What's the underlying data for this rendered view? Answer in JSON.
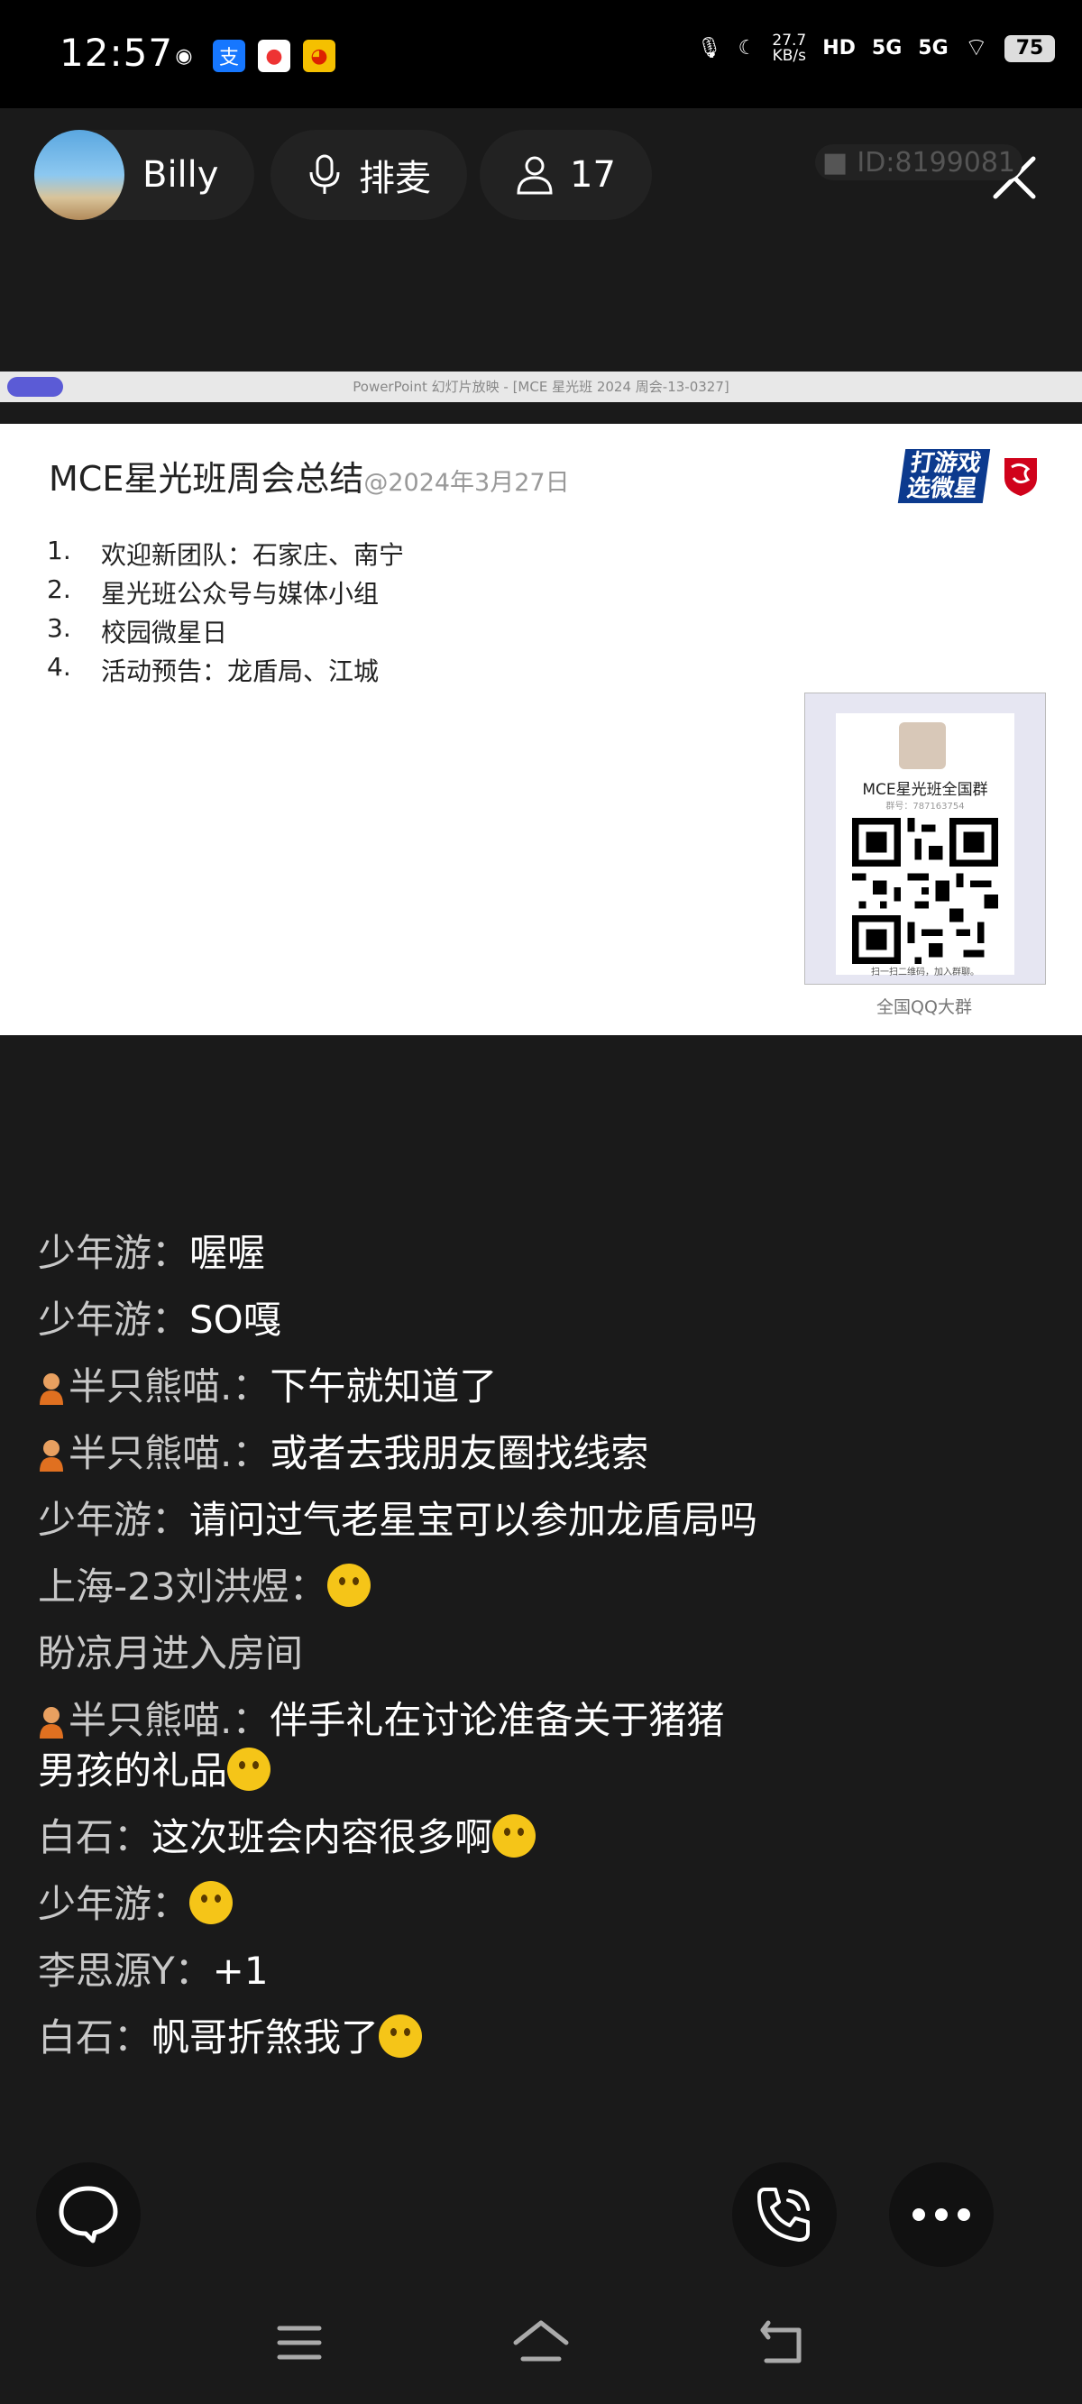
{
  "status_bar": {
    "time": "12:57",
    "apps": [
      "browser-icon",
      "alipay-icon",
      "maps-icon",
      "weibo-icon"
    ],
    "speed_value": "27.7",
    "speed_unit": "KB/s",
    "hd_label": "HD",
    "net1": "5G",
    "net2": "5G",
    "battery": "75"
  },
  "room": {
    "host_name": "Billy",
    "queue_label": "排麦",
    "audience_count": "17",
    "room_id": "ID:8199081"
  },
  "slide": {
    "ppt_title": "PowerPoint 幻灯片放映 - [MCE 星光班 2024 周会-13-0327]",
    "title": "MCE星光班周会总结",
    "date": "@2024年3月27日",
    "brand_line1": "打游戏",
    "brand_line2": "选微星",
    "agenda": [
      {
        "num": "1.",
        "text": "欢迎新团队：石家庄、南宁"
      },
      {
        "num": "2.",
        "text": "星光班公众号与媒体小组"
      },
      {
        "num": "3.",
        "text": "校园微星日"
      },
      {
        "num": "4.",
        "text": "活动预告：龙盾局、江城"
      }
    ],
    "qr": {
      "group_name": "MCE星光班全国群",
      "group_no": "群号：787163754",
      "scan_hint": "扫一扫二维码，加入群聊。",
      "caption": "全国QQ大群"
    }
  },
  "chat": {
    "messages": [
      {
        "user": "少年游：",
        "text": "喔喔"
      },
      {
        "user": "少年游：",
        "text": "SO嘎"
      },
      {
        "user": "半只熊喵.：",
        "text": "下午就知道了"
      },
      {
        "user": "半只熊喵.：",
        "text": "或者去我朋友圈找线索"
      },
      {
        "user": "少年游：",
        "text": "请问过气老星宝可以参加龙盾局吗"
      },
      {
        "user": "上海-23刘洪煜：",
        "text": ""
      },
      {
        "system": "盼凉月进入房间"
      },
      {
        "user": "半只熊喵.：",
        "text": "伴手礼在讨论准备关于猪猪男孩的礼品"
      },
      {
        "user": "白石：",
        "text": "这次班会内容很多啊"
      },
      {
        "user": "少年游：",
        "text": ""
      },
      {
        "user": "李思源Y：",
        "text": "+1"
      },
      {
        "user": "白石：",
        "text": "帆哥折煞我了"
      }
    ]
  },
  "colors": {
    "background": "#1a1a1a",
    "status_bar": "#000000",
    "pill": "#222222",
    "accent_blue": "#0c3a8e",
    "msi_red": "#d0021b",
    "emoji_yellow": "#f5c518"
  }
}
